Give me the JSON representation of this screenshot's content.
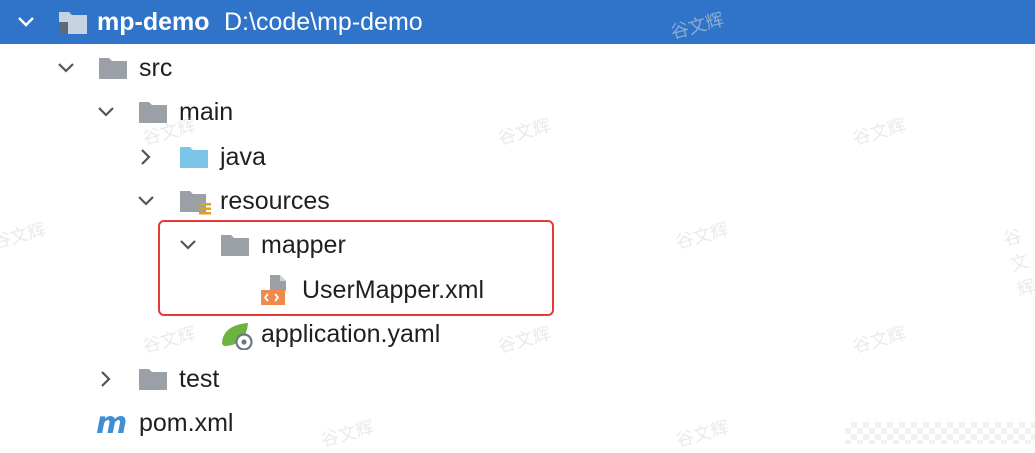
{
  "tree": {
    "root": {
      "name": "mp-demo",
      "path": "D:\\code\\mp-demo"
    },
    "items": [
      {
        "label": "src"
      },
      {
        "label": "main"
      },
      {
        "label": "java"
      },
      {
        "label": "resources"
      },
      {
        "label": "mapper"
      },
      {
        "label": "UserMapper.xml"
      },
      {
        "label": "application.yaml"
      },
      {
        "label": "test"
      },
      {
        "label": "pom.xml"
      }
    ]
  },
  "colors": {
    "selection": "#2f74c8",
    "highlight_border": "#e53935",
    "folder": "#9aa0a6",
    "source_folder": "#7cc4e8"
  },
  "watermark": "谷文辉"
}
